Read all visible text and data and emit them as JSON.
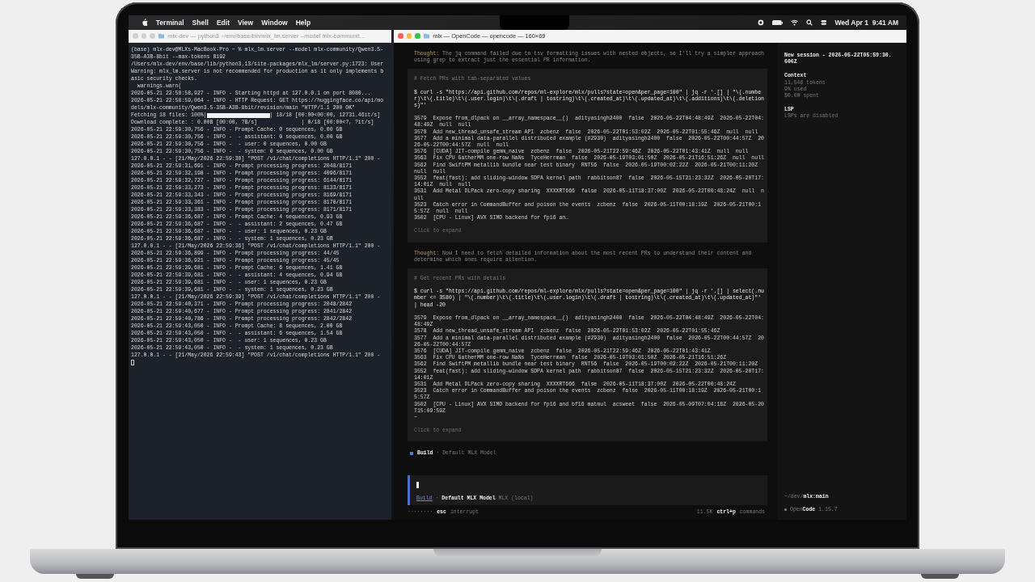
{
  "menubar": {
    "app": "Terminal",
    "menus": [
      "Shell",
      "Edit",
      "View",
      "Window",
      "Help"
    ],
    "clock": "Wed Apr 1  9:41 AM"
  },
  "windows": [
    {
      "kind": "terminal",
      "title": "mlx-dev — python3 ~/env/base/bin/mlx_lm.server --model mlx-communit…",
      "active": false,
      "lines": [
        {
          "kind": "text",
          "text": "(base) mlx-dev@MLXs-MacBook-Pro ~ % mlx_lm.server --model mlx-community/Qwen3.5-"
        },
        {
          "kind": "text",
          "text": "35B-A3B-8bit --max-tokens 8192"
        },
        {
          "kind": "text",
          "text": "/Users/mlx-dev/env/base/lib/python3.13/site-packages/mlx_lm/server.py:1723: User"
        },
        {
          "kind": "text",
          "text": "Warning: mlx_lm.server is not recommended for production as it only implements b"
        },
        {
          "kind": "text",
          "text": "asic security checks."
        },
        {
          "kind": "text",
          "text": "  warnings.warn("
        },
        {
          "kind": "text",
          "text": "2026-05-21 22:58:58,927 - INFO - Starting httpd at 127.0.0.1 on port 8080..."
        },
        {
          "kind": "text",
          "text": "2026-05-21 22:58:59,064 - INFO - HTTP Request: GET https://huggingface.co/api/mo"
        },
        {
          "kind": "text",
          "text": "dels/mlx-community/Qwen3.5-35B-A3B-8bit/revision/main \"HTTP/1.1 200 OK\""
        },
        {
          "kind": "progress",
          "before": "Fetching 18 files: 100%|",
          "level": 1,
          "after": "| 18/18 [00:00<00:00, 12731.46it/s]"
        },
        {
          "kind": "text",
          "text": "Download complete: : 0.00B [00:00, ?B/s]              | 0/18 [00:00<?, ?it/s]"
        },
        {
          "kind": "text",
          "text": "2026-05-21 22:59:30,756 - INFO - Prompt Cache: 0 sequences, 0.00 GB"
        },
        {
          "kind": "text",
          "text": "2026-05-21 22:59:30,756 - INFO -  - assistant: 0 sequences, 0.00 GB"
        },
        {
          "kind": "text",
          "text": "2026-05-21 22:59:30,756 - INFO -  - user: 0 sequences, 0.00 GB"
        },
        {
          "kind": "text",
          "text": "2026-05-21 22:59:30,756 - INFO -  - system: 0 sequences, 0.00 GB"
        },
        {
          "kind": "text",
          "text": "127.0.0.1 - - [21/May/2026 22:59:30] \"POST /v1/chat/completions HTTP/1.1\" 200 -"
        },
        {
          "kind": "text",
          "text": "2026-05-21 22:59:31,691 - INFO - Prompt processing progress: 2048/8171"
        },
        {
          "kind": "text",
          "text": "2026-05-21 22:59:32,198 - INFO - Prompt processing progress: 4096/8171"
        },
        {
          "kind": "text",
          "text": "2026-05-21 22:59:32,727 - INFO - Prompt processing progress: 6144/8171"
        },
        {
          "kind": "text",
          "text": "2026-05-21 22:59:33,273 - INFO - Prompt processing progress: 8133/8171"
        },
        {
          "kind": "text",
          "text": "2026-05-21 22:59:33,343 - INFO - Prompt processing progress: 8169/8171"
        },
        {
          "kind": "text",
          "text": "2026-05-21 22:59:33,361 - INFO - Prompt processing progress: 8170/8171"
        },
        {
          "kind": "text",
          "text": "2026-05-21 22:59:33,383 - INFO - Prompt processing progress: 8171/8171"
        },
        {
          "kind": "text",
          "text": "2026-05-21 22:59:36,687 - INFO - Prompt Cache: 4 sequences, 0.93 GB"
        },
        {
          "kind": "text",
          "text": "2026-05-21 22:59:36,687 - INFO -  - assistant: 2 sequences, 0.47 GB"
        },
        {
          "kind": "text",
          "text": "2026-05-21 22:59:36,687 - INFO -  - user: 1 sequences, 0.23 GB"
        },
        {
          "kind": "text",
          "text": "2026-05-21 22:59:36,687 - INFO -  - system: 1 sequences, 0.23 GB"
        },
        {
          "kind": "text",
          "text": "127.0.0.1 - - [21/May/2026 22:59:36] \"POST /v1/chat/completions HTTP/1.1\" 200 -"
        },
        {
          "kind": "text",
          "text": "2026-05-21 22:59:36,899 - INFO - Prompt processing progress: 44/45"
        },
        {
          "kind": "text",
          "text": "2026-05-21 22:59:36,921 - INFO - Prompt processing progress: 45/45"
        },
        {
          "kind": "text",
          "text": "2026-05-21 22:59:39,681 - INFO - Prompt Cache: 6 sequences, 1.41 GB"
        },
        {
          "kind": "text",
          "text": "2026-05-21 22:59:39,681 - INFO -  - assistant: 4 sequences, 0.94 GB"
        },
        {
          "kind": "text",
          "text": "2026-05-21 22:59:39,681 - INFO -  - user: 1 sequences, 0.23 GB"
        },
        {
          "kind": "text",
          "text": "2026-05-21 22:59:39,681 - INFO -  - system: 1 sequences, 0.23 GB"
        },
        {
          "kind": "text",
          "text": "127.0.0.1 - - [21/May/2026 22:59:39] \"POST /v1/chat/completions HTTP/1.1\" 200 -"
        },
        {
          "kind": "text",
          "text": "2026-05-21 22:59:40,371 - INFO - Prompt processing progress: 2048/2842"
        },
        {
          "kind": "text",
          "text": "2026-05-21 22:59:40,677 - INFO - Prompt processing progress: 2841/2842"
        },
        {
          "kind": "text",
          "text": "2026-05-21 22:59:40,786 - INFO - Prompt processing progress: 2842/2842"
        },
        {
          "kind": "text",
          "text": "2026-05-21 22:59:43,050 - INFO - Prompt Cache: 8 sequences, 2.00 GB"
        },
        {
          "kind": "text",
          "text": "2026-05-21 22:59:43,050 - INFO -  - assistant: 6 sequences, 1.54 GB"
        },
        {
          "kind": "text",
          "text": "2026-05-21 22:59:43,050 - INFO -  - user: 1 sequences, 0.23 GB"
        },
        {
          "kind": "text",
          "text": "2026-05-21 22:59:43,050 - INFO -  - system: 1 sequences, 0.23 GB"
        },
        {
          "kind": "text",
          "text": "127.0.0.1 - - [21/May/2026 22:59:43] \"POST /v1/chat/completions HTTP/1.1\" 200 -"
        },
        {
          "kind": "cursor"
        }
      ]
    },
    {
      "kind": "opencode",
      "title": "mlx — OpenCode — opencode — 160×69",
      "active": true,
      "messages": [
        {
          "kind": "thought",
          "label": "Thought:",
          "text": "The jq command failed due to tsv formatting issues with nested objects, so I'll try a simpler approach using grep to extract just the essential PR information."
        },
        {
          "kind": "tool",
          "comment": "# Fetch PRs with tab-separated values",
          "command": "$ curl -s \"https://api.github.com/repos/ml-explore/mlx/pulls?state=open&per_page=100\" | jq -r '.[] | \"\\(.number)\\t\\(.title)\\t\\(.user.login)\\t\\(.draft | tostring)\\t\\(.created_at)\\t\\(.updated_at)\\t\\(.additions)\\t\\(.deletions)\"'",
          "output": [
            "3579  Expose from_dlpack on __array_namespace__()  adityasingh2400  false  2026-05-22T04:48:49Z  2026-05-22T04:48:49Z  null  null",
            "3578  Add new_thread_unsafe_stream API  zcbenz  false  2026-05-22T01:53:02Z  2026-05-22T01:55:46Z  null  null",
            "3577  Add a minimal data-parallel distributed example (#2930)  adityasingh2400  false  2026-05-22T00:44:57Z  2026-05-22T00:44:57Z  null  null",
            "3576  [CUDA] JIT-compile gemm_naive  zcbenz  false  2026-05-21T22:59:46Z  2026-05-22T01:43:41Z  null  null",
            "3563  Fix CPU GatherMM one-row NaNs  TyceHerrman  false  2026-05-19T03:01:50Z  2026-05-21T16:51:26Z  null  null",
            "3562  Find SwiftPM metallib bundle near test binary  RNT56  false  2026-05-19T00:02:22Z  2026-05-21T00:11:20Z  null  null",
            "3552  feat(fast): add sliding-window SDPA kernel path  rabbitson87  false  2026-05-15T21:23:32Z  2026-05-20T17:14:01Z  null  null",
            "3531  Add Metal DLPack zero-copy sharing  XXXXRT666  false  2026-05-11T18:37:00Z  2026-05-22T00:48:24Z  null  null",
            "3523  Catch error in CommandBuffer and poison the events  zcbenz  false  2026-05-11T00:18:19Z  2026-05-21T00:15:57Z  null  null",
            "3502  [CPU - Linux] AVX SIMD backend for fp16 an…"
          ],
          "expand": "Click to expand"
        },
        {
          "kind": "thought",
          "label": "Thought:",
          "text": "Now I need to fetch detailed information about the most recent PRs to understand their content and determine which ones require attention."
        },
        {
          "kind": "tool",
          "comment": "# Get recent PRs with details",
          "command": "$ curl -s \"https://api.github.com/repos/ml-explore/mlx/pulls?state=open&per_page=100\" | jq -r '.[] | select(.number <= 3580) | \"\\(.number)\\t\\(.title)\\t\\(.user.login)\\t\\(.draft | tostring)\\t\\(.created_at)\\t\\(.updated_at)\"' | head -20",
          "output": [
            "3579  Expose from_dlpack on __array_namespace__()  adityasingh2400  false  2026-05-22T04:48:49Z  2026-05-22T04:48:49Z",
            "3578  Add new_thread_unsafe_stream API  zcbenz  false  2026-05-22T01:53:02Z  2026-05-22T01:55:46Z",
            "3577  Add a minimal data-parallel distributed example (#2930)  adityasingh2400  false  2026-05-22T00:44:57Z  2026-05-22T00:44:57Z",
            "3576  [CUDA] JIT-compile gemm_naive  zcbenz  false  2026-05-21T22:59:46Z  2026-05-22T01:43:41Z",
            "3563  Fix CPU GatherMM one-row NaNs  TyceHerrman  false  2026-05-19T03:01:50Z  2026-05-21T16:51:26Z",
            "3562  Find SwiftPM metallib bundle near test binary  RNT56  false  2026-05-19T00:02:22Z  2026-05-21T00:11:20Z",
            "3552  feat(fast): add sliding-window SDPA kernel path  rabbitson87  false  2026-05-15T21:23:32Z  2026-05-20T17:14:01Z",
            "3531  Add Metal DLPack zero-copy sharing  XXXXRT666  false  2026-05-11T18:37:00Z  2026-05-22T00:48:24Z",
            "3523  Catch error in CommandBuffer and poison the events  zcbenz  false  2026-05-11T00:18:19Z  2026-05-21T00:15:57Z",
            "3502  [CPU - Linux] AVX SIMD backend for fp16 and bf16 matmul  acsweet  false  2026-05-09T07:04:18Z  2026-05-20T15:09:59Z",
            "~"
          ],
          "expand": "Click to expand"
        }
      ],
      "agent": {
        "text": "**Build** · Default MLX Model"
      },
      "prompt": {
        "mode": "Build",
        "model": "· **Default MLX Model** MLX (local)"
      },
      "status": {
        "spinner": "········",
        "key": "esc",
        "action": "interrupt",
        "tokens": "11.5K",
        "shortcut_key": "ctrl+p",
        "shortcut_action": "commands"
      },
      "sidebar": {
        "title": "New session - 2026-05-22T05:59:30.606Z",
        "sections": [
          {
            "heading": "Context",
            "lines": [
              "11,546 tokens",
              "9% used",
              "$0.00 spent"
            ]
          },
          {
            "heading": "LSP",
            "lines": [
              "LSPs are disabled"
            ]
          }
        ],
        "path": "~/dev/**mlx:main**",
        "app": "Open**Code**",
        "version": "1.15.7"
      }
    }
  ]
}
